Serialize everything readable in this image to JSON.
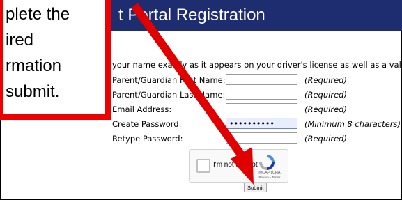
{
  "portal": {
    "title": "t Portal Registration"
  },
  "intro_text": "your name exactly as it appears on your driver's license as well as a valid email",
  "form": {
    "rows": [
      {
        "label": "Parent/Guardian First Name:",
        "value": "",
        "requirement": "(Required)"
      },
      {
        "label": "Parent/Guardian Last Name:",
        "value": "",
        "requirement": "(Required)"
      },
      {
        "label": "Email Address:",
        "value": "",
        "requirement": "(Required)"
      },
      {
        "label": "Create Password:",
        "value": "••••••••••",
        "requirement": "(Minimum 8 characters)"
      },
      {
        "label": "Retype Password:",
        "value": "",
        "requirement": "(Required)"
      }
    ],
    "submit_label": "Submit"
  },
  "captcha": {
    "label": "I'm not a robot",
    "brand": "reCAPTCHA",
    "terms": "Privacy - Terms"
  },
  "callout": {
    "lines": [
      "plete the",
      "ired",
      "rmation",
      "submit."
    ]
  },
  "colors": {
    "header_bg": "#1e2c70",
    "callout_border": "#e00000",
    "arrow": "#e00000"
  }
}
